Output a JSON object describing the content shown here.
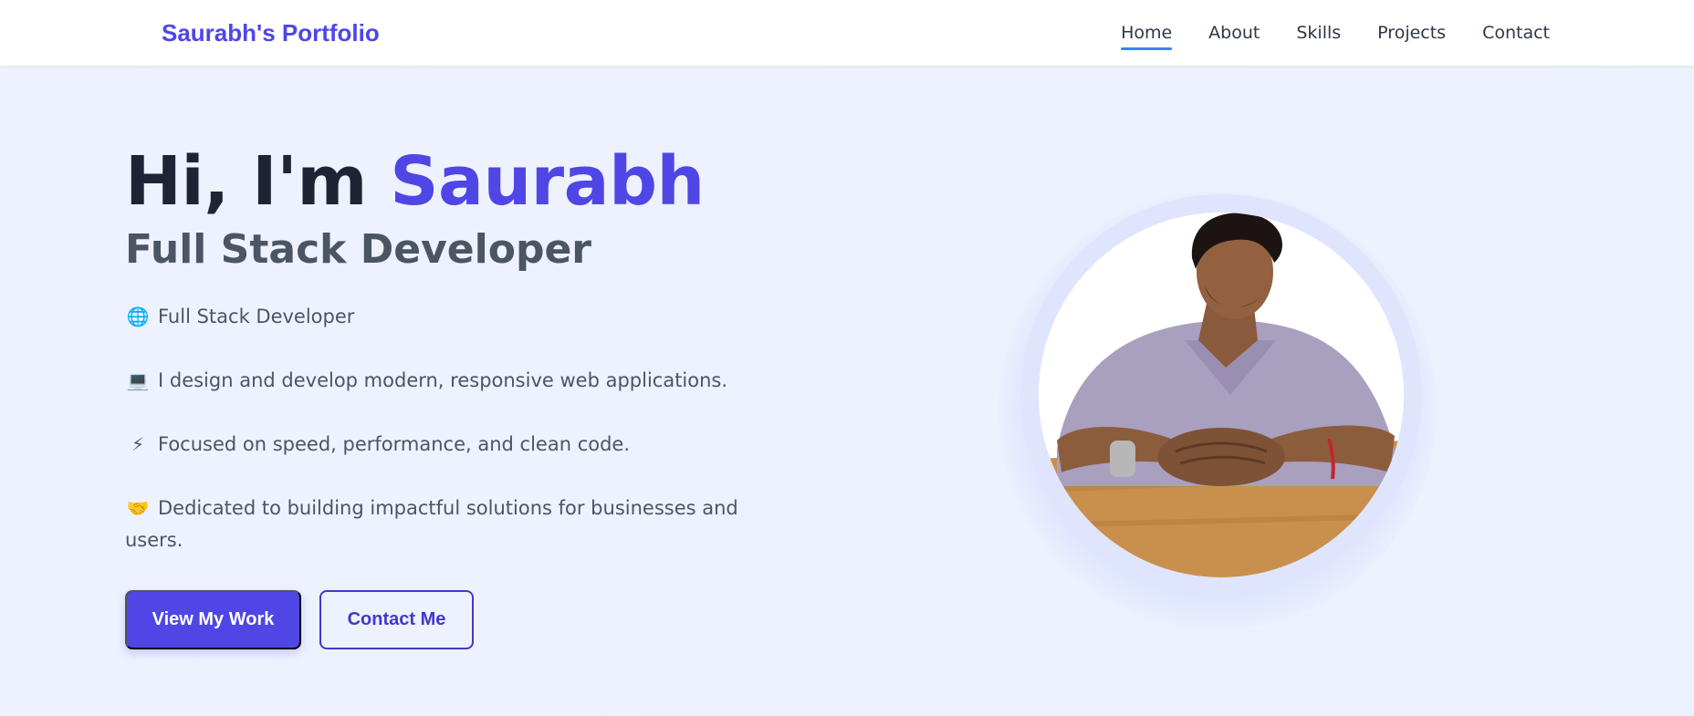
{
  "nav": {
    "brand": "Saurabh's Portfolio",
    "links": [
      {
        "label": "Home",
        "active": true
      },
      {
        "label": "About",
        "active": false
      },
      {
        "label": "Skills",
        "active": false
      },
      {
        "label": "Projects",
        "active": false
      },
      {
        "label": "Contact",
        "active": false
      }
    ]
  },
  "hero": {
    "greeting": "Hi, I'm ",
    "name": "Saurabh",
    "subtitle": "Full Stack Developer",
    "bullets": [
      {
        "icon": "globe-icon",
        "emoji": "🌐",
        "text": "Full Stack Developer"
      },
      {
        "icon": "laptop-icon",
        "emoji": "💻",
        "text": "I design and develop modern, responsive web applications."
      },
      {
        "icon": "lightning-icon",
        "emoji": "⚡",
        "text": "Focused on speed, performance, and clean code."
      },
      {
        "icon": "handshake-icon",
        "emoji": "🤝",
        "text": "Dedicated to building impactful solutions for businesses and users."
      }
    ],
    "primary_button": "View My Work",
    "secondary_button": "Contact Me"
  },
  "colors": {
    "accent": "#4f46e5",
    "heading": "#1e2433",
    "background": "#eef2fe",
    "nav_active_underline": "#3b82f6"
  }
}
